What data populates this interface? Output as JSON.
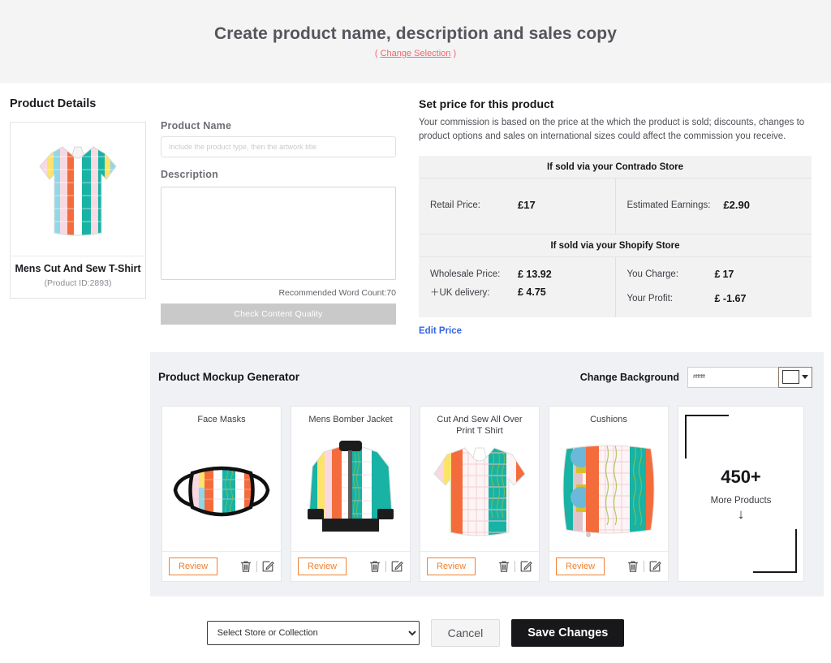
{
  "header": {
    "title": "Create product name, description and sales copy",
    "change_selection_label": "Change Selection",
    "paren_open": "(",
    "paren_close": ")",
    "accent_color": "#f2636f"
  },
  "product_details": {
    "section_title": "Product Details",
    "name": "Mens Cut And Sew T-Shirt",
    "product_id_label": "(Product ID:2893)",
    "thumb_icon": "tshirt-striped-icon"
  },
  "form": {
    "product_name_label": "Product Name",
    "product_name_value": "",
    "product_name_placeholder": "Include the product type, then the artwork title",
    "description_label": "Description",
    "description_value": "",
    "description_placeholder": "",
    "word_count_text": "Recommended Word Count:70",
    "check_quality_label": "Check Content Quality"
  },
  "pricing": {
    "title": "Set price for this product",
    "description": "Your commission is based on the price at the which the product is sold; discounts, changes to product options and sales on international sizes could affect the commission you receive.",
    "contrado_band": "If sold via your Contrado Store",
    "retail_price_label": "Retail Price:",
    "retail_price_currency": "£",
    "retail_price_value": "17",
    "estimated_earnings_label": "Estimated Earnings:",
    "estimated_earnings_value": "£2.90",
    "shopify_band": "If sold via your Shopify Store",
    "wholesale_price_label": "Wholesale Price:",
    "wholesale_price_value": "£ 13.92",
    "uk_delivery_label": "＋UK delivery:",
    "uk_delivery_value": "£ 4.75",
    "you_charge_label": "You Charge:",
    "you_charge_currency": "£",
    "you_charge_value": "17",
    "your_profit_label": "Your Profit:",
    "your_profit_value": "£ -1.67",
    "edit_price_label": "Edit Price",
    "link_color": "#3665e3"
  },
  "mockup": {
    "panel_title": "Product Mockup Generator",
    "change_background_label": "Change Background",
    "background_value": "#ffffff",
    "background_swatch_color": "#ffffff",
    "color_picker_icon": "color-swatch-icon",
    "caret_icon": "chevron-down-icon",
    "review_label": "Review",
    "delete_icon": "trash-icon",
    "edit_icon": "pencil-square-icon",
    "cards": [
      {
        "title": "Face Masks",
        "art": "face-mask-striped-icon"
      },
      {
        "title": "Mens Bomber Jacket",
        "art": "bomber-jacket-striped-icon"
      },
      {
        "title": "Cut And Sew All Over Print T Shirt",
        "art": "tshirt-allover-striped-icon"
      },
      {
        "title": "Cushions",
        "art": "cushion-striped-icon"
      }
    ],
    "more_products": {
      "count": "450+",
      "label": "More Products",
      "arrow": "↓",
      "arrow_icon": "arrow-down-icon"
    }
  },
  "footer": {
    "store_select_value": "Select Store or Collection",
    "store_select_options": [
      "Select Store or Collection"
    ],
    "cancel_label": "Cancel",
    "save_label": "Save Changes"
  }
}
